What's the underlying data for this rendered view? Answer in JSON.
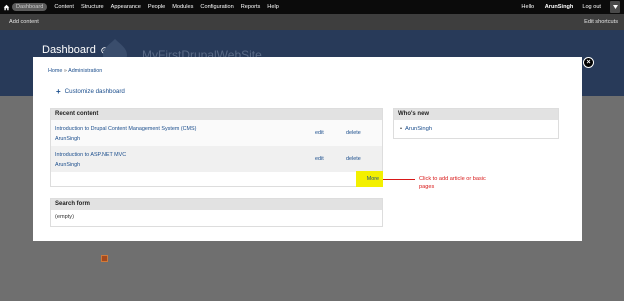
{
  "toolbar": {
    "menu": [
      "Dashboard",
      "Content",
      "Structure",
      "Appearance",
      "People",
      "Modules",
      "Configuration",
      "Reports",
      "Help"
    ],
    "hello_prefix": "Hello ",
    "username": "ArunSingh",
    "logout": "Log out"
  },
  "shortcuts": {
    "add": "Add content",
    "edit": "Edit shortcuts"
  },
  "header": {
    "title": "Dashboard",
    "site_name": "MyFirstDrupalWebSite"
  },
  "breadcrumb": {
    "home": "Home",
    "separator": "»",
    "admin": "Administration"
  },
  "customize": "Customize dashboard",
  "recent": {
    "title": "Recent content",
    "rows": [
      {
        "title": "Introduction to Drupal Content Management System (CMS)",
        "author": "ArunSingh",
        "edit": "edit",
        "delete": "delete"
      },
      {
        "title": "Introduction to ASP.NET MVC",
        "author": "ArunSingh",
        "edit": "edit",
        "delete": "delete"
      }
    ],
    "more": "More"
  },
  "search": {
    "title": "Search form",
    "body": "(empty)"
  },
  "whos_new": {
    "title": "Who's new",
    "users": [
      "ArunSingh"
    ]
  },
  "annotation": "Click to add article or basic pages",
  "colors": {
    "toolbar": "#0b0b0b",
    "header": "#283a59",
    "link": "#1a4d8c",
    "highlight": "#f3f000",
    "annotation": "#d81818"
  }
}
